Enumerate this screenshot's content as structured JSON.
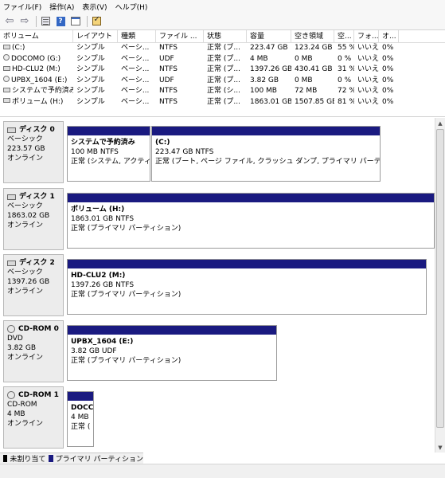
{
  "menu": [
    "ファイル(F)",
    "操作(A)",
    "表示(V)",
    "ヘルプ(H)"
  ],
  "toolbar": {
    "icons": [
      "back-arrow-icon",
      "forward-arrow-icon",
      "properties-icon",
      "help-icon",
      "window-icon",
      "check-icon"
    ],
    "back": "⇦",
    "forward": "⇨",
    "help": "?"
  },
  "volume_table": {
    "columns": [
      "ボリューム",
      "レイアウト",
      "種類",
      "ファイル ...",
      "状態",
      "容量",
      "空き領域",
      "空...",
      "フォ...",
      "オ..."
    ],
    "rows": [
      [
        "(C:)",
        "シンプル",
        "ベーシ...",
        "NTFS",
        "正常 (ブ...",
        "223.47 GB",
        "123.24 GB",
        "55 %",
        "いいえ",
        "0%"
      ],
      [
        "DOCOMO (G:)",
        "シンプル",
        "ベーシ...",
        "UDF",
        "正常 (プ...",
        "4 MB",
        "0 MB",
        "0 %",
        "いいえ",
        "0%"
      ],
      [
        "HD-CLU2 (M:)",
        "シンプル",
        "ベーシ...",
        "NTFS",
        "正常 (プ...",
        "1397.26 GB",
        "430.41 GB",
        "31 %",
        "いいえ",
        "0%"
      ],
      [
        "UPBX_1604 (E:)",
        "シンプル",
        "ベーシ...",
        "UDF",
        "正常 (プ...",
        "3.82 GB",
        "0 MB",
        "0 %",
        "いいえ",
        "0%"
      ],
      [
        "システムで予約済み",
        "シンプル",
        "ベーシ...",
        "NTFS",
        "正常 (シ...",
        "100 MB",
        "72 MB",
        "72 %",
        "いいえ",
        "0%"
      ],
      [
        "ボリューム (H:)",
        "シンプル",
        "ベーシ...",
        "NTFS",
        "正常 (プ...",
        "1863.01 GB",
        "1507.85 GB",
        "81 %",
        "いいえ",
        "0%"
      ]
    ]
  },
  "disks": [
    {
      "name": "ディスク 0",
      "type": "ベーシック",
      "size": "223.57 GB",
      "status": "オンライン",
      "kind": "hdd",
      "partitions": [
        {
          "label": "システムで予約済み",
          "size": "100 MB NTFS",
          "status": "正常 (システム, アクティ"
        },
        {
          "label": "(C:)",
          "size": "223.47 GB NTFS",
          "status": "正常 (ブート, ページ ファイル, クラッシュ ダンプ, プライマリ パーティ"
        }
      ]
    },
    {
      "name": "ディスク 1",
      "type": "ベーシック",
      "size": "1863.02 GB",
      "status": "オンライン",
      "kind": "hdd",
      "partitions": [
        {
          "label": "ボリューム (H:)",
          "size": "1863.01 GB NTFS",
          "status": "正常 (プライマリ パーティション)"
        }
      ]
    },
    {
      "name": "ディスク 2",
      "type": "ベーシック",
      "size": "1397.26 GB",
      "status": "オンライン",
      "kind": "hdd",
      "partitions": [
        {
          "label": "HD-CLU2 (M:)",
          "size": "1397.26 GB NTFS",
          "status": "正常 (プライマリ パーティション)"
        }
      ]
    },
    {
      "name": "CD-ROM 0",
      "type": "DVD",
      "size": "3.82 GB",
      "status": "オンライン",
      "kind": "cd",
      "partitions": [
        {
          "label": "UPBX_1604 (E:)",
          "size": "3.82 GB UDF",
          "status": "正常 (プライマリ パーティション)"
        }
      ]
    },
    {
      "name": "CD-ROM 1",
      "type": "CD-ROM",
      "size": "4 MB",
      "status": "オンライン",
      "kind": "cd",
      "partitions": [
        {
          "label": "DOCC",
          "size": "4 MB",
          "status": "正常 ("
        }
      ]
    }
  ],
  "legend": {
    "unallocated": "未割り当て",
    "primary": "プライマリ パーティション",
    "unallocated_color": "#000000",
    "primary_color": "#1a1a80"
  }
}
